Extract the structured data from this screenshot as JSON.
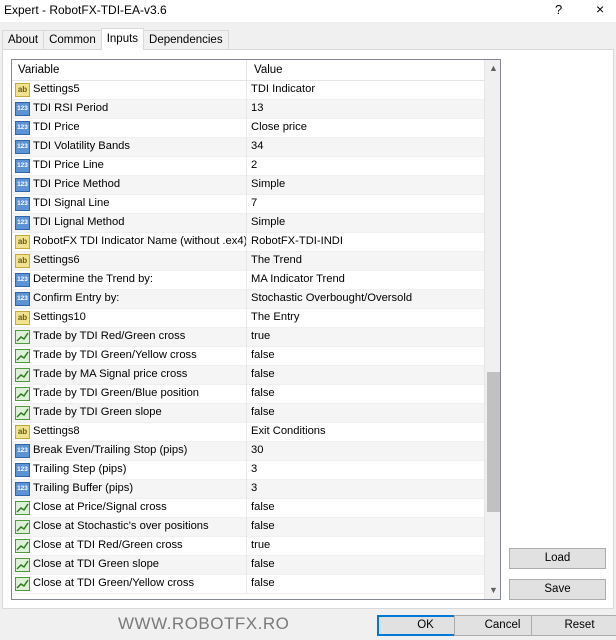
{
  "window": {
    "title": "Expert - RobotFX-TDI-EA-v3.6",
    "help_label": "?",
    "close_label": "×"
  },
  "tabs": [
    {
      "label": "About",
      "active": false
    },
    {
      "label": "Common",
      "active": false
    },
    {
      "label": "Inputs",
      "active": true
    },
    {
      "label": "Dependencies",
      "active": false
    }
  ],
  "grid": {
    "header_variable": "Variable",
    "header_value": "Value",
    "rows": [
      {
        "icon": "ab",
        "name": "Settings5",
        "value": "TDI Indicator"
      },
      {
        "icon": "123",
        "name": "TDI RSI Period",
        "value": "13"
      },
      {
        "icon": "123",
        "name": "TDI Price",
        "value": "Close price"
      },
      {
        "icon": "123",
        "name": "TDI Volatility Bands",
        "value": "34"
      },
      {
        "icon": "123",
        "name": "TDI Price Line",
        "value": "2"
      },
      {
        "icon": "123",
        "name": "TDI Price Method",
        "value": "Simple"
      },
      {
        "icon": "123",
        "name": "TDI Signal Line",
        "value": "7"
      },
      {
        "icon": "123",
        "name": "TDI Lignal Method",
        "value": "Simple"
      },
      {
        "icon": "ab",
        "name": "RobotFX TDI Indicator Name (without .ex4)",
        "value": "RobotFX-TDI-INDI"
      },
      {
        "icon": "ab",
        "name": "Settings6",
        "value": "The Trend"
      },
      {
        "icon": "123",
        "name": "Determine the Trend by:",
        "value": "MA Indicator Trend"
      },
      {
        "icon": "123",
        "name": "Confirm Entry by:",
        "value": "Stochastic Overbought/Oversold"
      },
      {
        "icon": "ab",
        "name": "Settings10",
        "value": "The Entry"
      },
      {
        "icon": "switch",
        "name": "Trade by TDI Red/Green cross",
        "value": "true"
      },
      {
        "icon": "switch",
        "name": "Trade by TDI Green/Yellow cross",
        "value": "false"
      },
      {
        "icon": "switch",
        "name": "Trade by MA Signal price cross",
        "value": "false"
      },
      {
        "icon": "switch",
        "name": "Trade by TDI Green/Blue position",
        "value": "false"
      },
      {
        "icon": "switch",
        "name": "Trade by TDI Green slope",
        "value": "false"
      },
      {
        "icon": "ab",
        "name": "Settings8",
        "value": "Exit Conditions"
      },
      {
        "icon": "123",
        "name": "Break Even/Trailing Stop (pips)",
        "value": "30"
      },
      {
        "icon": "123",
        "name": "Trailing Step (pips)",
        "value": "3"
      },
      {
        "icon": "123",
        "name": "Trailing Buffer (pips)",
        "value": "3"
      },
      {
        "icon": "switch",
        "name": "Close at Price/Signal cross",
        "value": "false"
      },
      {
        "icon": "switch",
        "name": "Close at Stochastic's over positions",
        "value": "false"
      },
      {
        "icon": "switch",
        "name": "Close at TDI Red/Green cross",
        "value": "true"
      },
      {
        "icon": "switch",
        "name": "Close at TDI Green slope",
        "value": "false"
      },
      {
        "icon": "switch",
        "name": "Close at TDI Green/Yellow cross",
        "value": "false"
      }
    ]
  },
  "buttons": {
    "load": "Load",
    "save": "Save",
    "ok": "OK",
    "cancel": "Cancel",
    "reset": "Reset"
  },
  "brand_text": "WWW.ROBOTFX.RO",
  "icons": {
    "string": "ab-icon",
    "number": "123-icon",
    "bool": "switch-icon",
    "scroll_up": "chevron-up-icon",
    "scroll_down": "chevron-down-icon"
  }
}
